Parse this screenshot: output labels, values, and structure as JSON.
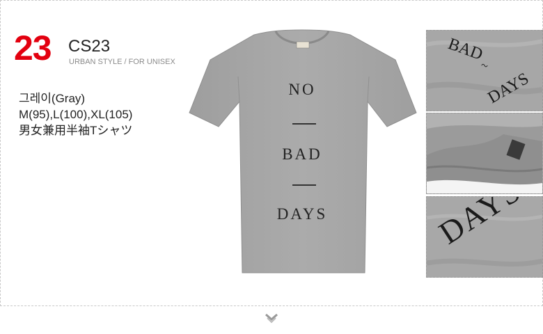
{
  "product": {
    "number": "23",
    "code": "CS23",
    "tagline": "URBAN STYLE / FOR UNISEX",
    "color": "그레이(Gray)",
    "sizes": "M(95),L(100),XL(105)",
    "description": "男女兼用半袖Tシャツ"
  },
  "print": {
    "line1": "NO",
    "line2": "BAD",
    "line3": "DAYS"
  },
  "thumbs": {
    "t1_line1": "BAD",
    "t1_line2": "DAYS",
    "t3_word": "DAYS"
  },
  "icons": {
    "more": "chevron-down-icon"
  },
  "colors": {
    "accent": "#e3000f",
    "shirt": "#a6a6a6"
  }
}
